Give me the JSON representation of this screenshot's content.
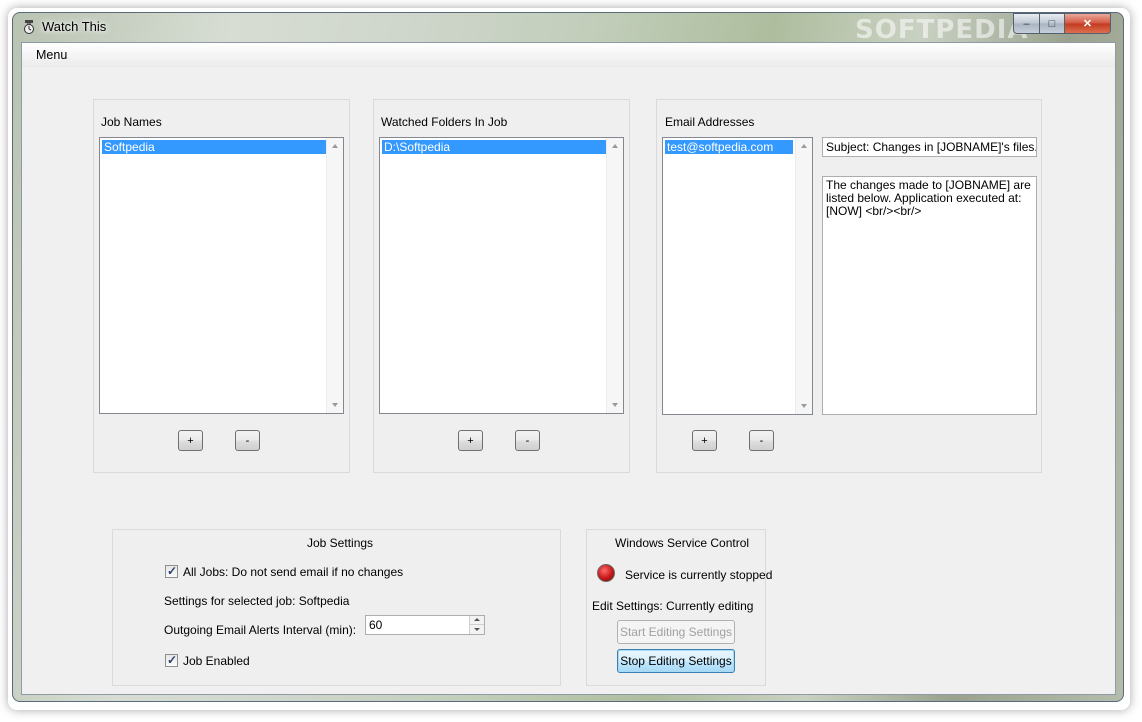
{
  "window": {
    "title": "Watch This",
    "watermark": "SOFTPEDIA",
    "controls": {
      "minimize": "–",
      "maximize": "□",
      "close": "✕"
    }
  },
  "menu": {
    "label": "Menu"
  },
  "jobs": {
    "label": "Job Names",
    "items": [
      "Softpedia"
    ],
    "add_label": "+",
    "remove_label": "-"
  },
  "folders": {
    "label": "Watched Folders In Job",
    "items": [
      "D:\\Softpedia"
    ],
    "add_label": "+",
    "remove_label": "-"
  },
  "emails": {
    "label": "Email Addresses",
    "items": [
      "test@softpedia.com"
    ],
    "subject": "Subject: Changes in [JOBNAME]'s files.",
    "body": "The changes made to [JOBNAME] are listed below. Application executed at: [NOW] <br/><br/>",
    "add_label": "+",
    "remove_label": "-"
  },
  "job_settings": {
    "title": "Job Settings",
    "all_jobs_label": "All Jobs: Do not send email if no changes",
    "all_jobs_checked": true,
    "selected_job_text": "Settings for selected job: Softpedia",
    "interval_label": "Outgoing Email Alerts Interval (min):",
    "interval_value": "60",
    "job_enabled_label": "Job Enabled",
    "job_enabled_checked": true
  },
  "service_control": {
    "title": "Windows Service Control",
    "status_text": "Service is currently stopped",
    "status_color": "#c41818",
    "edit_status": "Edit Settings: Currently editing",
    "start_label": "Start Editing Settings",
    "stop_label": "Stop Editing Settings"
  }
}
